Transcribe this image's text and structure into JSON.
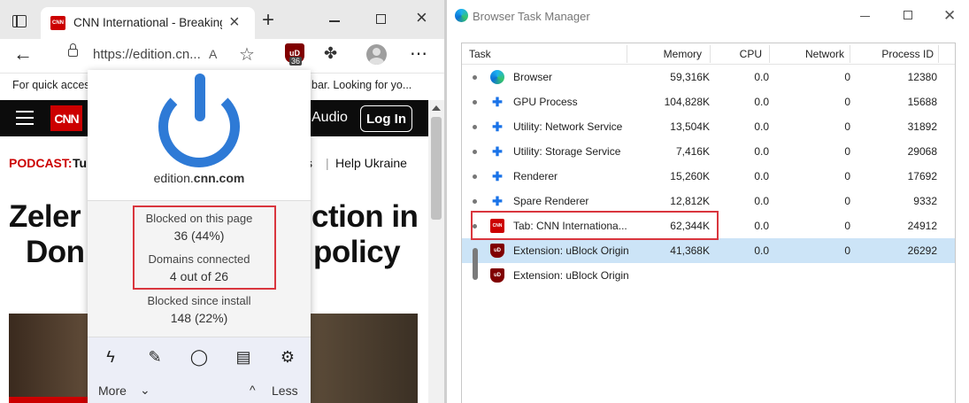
{
  "browser": {
    "tab": {
      "title": "CNN International - Breaking Ne",
      "favicon_text": "CNN"
    },
    "url": "https://edition.cn...",
    "read_aloud_label": "A",
    "ublock_badge": "36",
    "ublock_icon_text": "uD",
    "favorites_bar": {
      "text_left": "For quick access",
      "text_right": "bar. Looking for yo..."
    },
    "page": {
      "logo": "CNN",
      "nav_audio": "Audio",
      "nav_login": "Log In",
      "podcast_label": "PODCAST:",
      "podcast_text": "Tu",
      "nav_partial": "s",
      "nav_sep": "|",
      "nav_ukraine": "Help Ukraine",
      "headline_line1_left": "Zeler",
      "headline_line1_right": "ction in",
      "headline_line2_left": "Don",
      "headline_line2_right": "policy"
    }
  },
  "ublock_popup": {
    "hostname_prefix": "edition.",
    "hostname_domain": "cnn.com",
    "blocked_label": "Blocked on this page",
    "blocked_value": "36 (44%)",
    "domains_label": "Domains connected",
    "domains_value": "4 out of 26",
    "since_label": "Blocked since install",
    "since_value": "148 (22%)",
    "more_label": "More",
    "less_label": "Less",
    "power_color": "#2e7ad6"
  },
  "task_manager": {
    "title": "Browser Task Manager",
    "columns": [
      "Task",
      "Memory",
      "CPU",
      "Network",
      "Process ID"
    ],
    "rows": [
      {
        "icon": "edge-icon",
        "name": "Browser",
        "memory": "59,316K",
        "cpu": "0.0",
        "network": "0",
        "pid": "12380"
      },
      {
        "icon": "puzzle-icon",
        "name": "GPU Process",
        "memory": "104,828K",
        "cpu": "0.0",
        "network": "0",
        "pid": "15688"
      },
      {
        "icon": "puzzle-icon",
        "name": "Utility: Network Service",
        "memory": "13,504K",
        "cpu": "0.0",
        "network": "0",
        "pid": "31892"
      },
      {
        "icon": "puzzle-icon",
        "name": "Utility: Storage Service",
        "memory": "7,416K",
        "cpu": "0.0",
        "network": "0",
        "pid": "29068"
      },
      {
        "icon": "puzzle-icon",
        "name": "Renderer",
        "memory": "15,260K",
        "cpu": "0.0",
        "network": "0",
        "pid": "17692"
      },
      {
        "icon": "puzzle-icon",
        "name": "Spare Renderer",
        "memory": "12,812K",
        "cpu": "0.0",
        "network": "0",
        "pid": "9332"
      },
      {
        "icon": "cnn-icon",
        "name": "Tab: CNN Internationa...",
        "memory": "62,344K",
        "cpu": "0.0",
        "network": "0",
        "pid": "24912"
      },
      {
        "icon": "ublock-icon",
        "name": "Extension: uBlock Origin",
        "memory": "41,368K",
        "cpu": "0.0",
        "network": "0",
        "pid": "26292"
      },
      {
        "icon": "ublock-icon",
        "name": "Extension: uBlock Origin",
        "memory": "",
        "cpu": "",
        "network": "",
        "pid": ""
      }
    ],
    "selection_color": "#cce4f7",
    "highlight_color": "#d9363e"
  }
}
